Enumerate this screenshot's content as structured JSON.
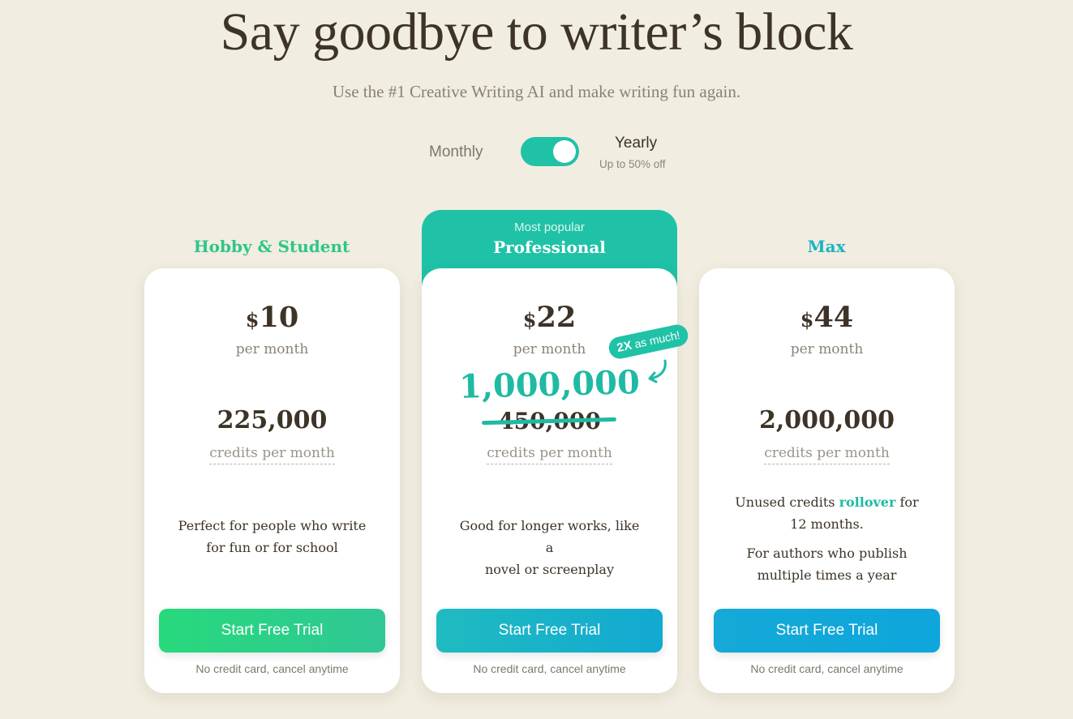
{
  "hero": {
    "title": "Say goodbye to writer’s block",
    "subtitle": "Use the #1 Creative Writing AI and make writing fun again."
  },
  "billing_toggle": {
    "monthly_label": "Monthly",
    "yearly_label": "Yearly",
    "yearly_note": "Up to 50% off",
    "selected": "Yearly"
  },
  "plans": [
    {
      "name": "Hobby & Student",
      "currency": "$",
      "price": "10",
      "period": "per month",
      "credits": "225,000",
      "credits_unit": "credits per month",
      "description": [
        "Perfect for people who write",
        "for fun or for school"
      ],
      "cta": "Start Free Trial",
      "note": "No credit card, cancel anytime",
      "accent_color": "#2ec68a"
    },
    {
      "badge_top": "Most popular",
      "name": "Professional",
      "currency": "$",
      "price": "22",
      "period": "per month",
      "promo_badge_strong": "2X",
      "promo_badge_rest": "as much!",
      "credits": "1,000,000",
      "credits_old": "450,000",
      "credits_unit": "credits per month",
      "description": [
        "Good for longer works, like a",
        "novel or screenplay"
      ],
      "cta": "Start Free Trial",
      "note": "No credit card, cancel anytime",
      "accent_color": "#1fc2a7"
    },
    {
      "name": "Max",
      "currency": "$",
      "price": "44",
      "period": "per month",
      "credits": "2,000,000",
      "credits_unit": "credits per month",
      "rollover_pre": "Unused credits ",
      "rollover_word": "rollover",
      "rollover_post": " for",
      "rollover_line2": "12 months.",
      "description": [
        "For authors who publish",
        "multiple times a year"
      ],
      "cta": "Start Free Trial",
      "note": "No credit card, cancel anytime",
      "accent_color": "#1ab4c4"
    }
  ]
}
